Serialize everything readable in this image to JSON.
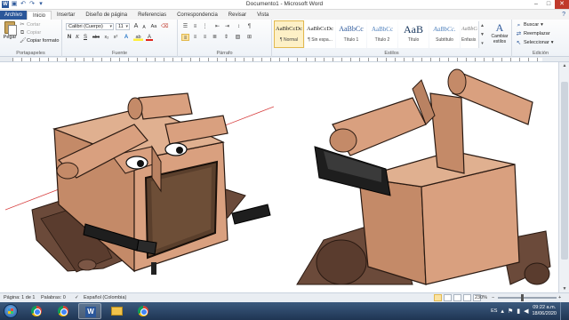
{
  "window": {
    "title": "Documento1 - Microsoft Word",
    "controls": [
      "minimize",
      "maximize",
      "close"
    ]
  },
  "quick_access": [
    "save-icon",
    "undo-icon",
    "redo-icon",
    "customize-icon"
  ],
  "tabs": [
    {
      "label": "Archivo",
      "type": "file"
    },
    {
      "label": "Inicio",
      "active": true
    },
    {
      "label": "Insertar"
    },
    {
      "label": "Diseño de página"
    },
    {
      "label": "Referencias"
    },
    {
      "label": "Correspondencia"
    },
    {
      "label": "Revisar"
    },
    {
      "label": "Vista"
    }
  ],
  "ribbon": {
    "clipboard": {
      "label": "Portapapeles",
      "paste": "Pegar",
      "cut": "Cortar",
      "copy": "Copiar",
      "format_painter": "Copiar formato"
    },
    "font": {
      "label": "Fuente",
      "font_name": "Calibri (Cuerpo)",
      "font_size": "11",
      "grow": "A",
      "shrink": "A",
      "case": "Aa",
      "bold": "N",
      "italic": "K",
      "underline": "S",
      "strike": "abc",
      "subscript": "x₂",
      "superscript": "x²",
      "effects": "A",
      "highlight": "ab",
      "color": "A"
    },
    "paragraph": {
      "label": "Párrafo"
    },
    "styles": {
      "label": "Estilos",
      "items": [
        {
          "sample": "AaBbCcDc",
          "name": "¶ Normal",
          "selected": true
        },
        {
          "sample": "AaBbCcDc",
          "name": "¶ Sin espa..."
        },
        {
          "sample": "AaBbCc",
          "name": "Título 1"
        },
        {
          "sample": "AaBbCc",
          "name": "Título 2"
        },
        {
          "sample": "AaB",
          "name": "Título"
        },
        {
          "sample": "AaBbCc.",
          "name": "Subtítulo"
        },
        {
          "sample": "AaBbCcDc",
          "name": "Énfasis sutil"
        }
      ],
      "change_styles": "Cambiar estilos"
    },
    "editing": {
      "label": "Edición",
      "find": "Buscar",
      "replace": "Reemplazar",
      "select": "Seleccionar"
    }
  },
  "status": {
    "page": "Página: 1 de 1",
    "words": "Palabras: 0",
    "language": "Español (Colombia)",
    "zoom": "230%",
    "zoom_fraction": 0.42
  },
  "taskbar": {
    "apps": [
      "chrome-icon",
      "chrome-icon",
      "word-icon",
      "explorer-icon",
      "chrome-icon"
    ],
    "lang": "ES",
    "time": "09:22 a.m.",
    "date": "18/06/2020"
  },
  "colors": {
    "word_blue": "#2b579a",
    "model_body": "#d9a07f",
    "model_shadow": "#b98262",
    "tracks": "#6b4a3a",
    "taskbar": "#1f3553"
  }
}
